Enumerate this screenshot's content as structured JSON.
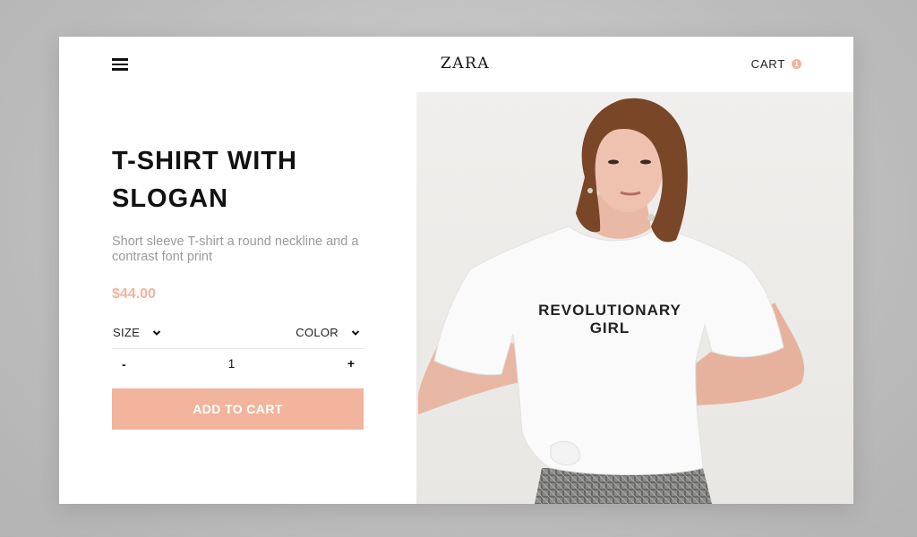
{
  "brand": {
    "logo": "ZARA"
  },
  "header": {
    "cart_label": "CART",
    "cart_count": "1"
  },
  "product": {
    "title_line1": "T-SHIRT WITH",
    "title_line2": "SLOGAN",
    "description": "Short sleeve T-shirt a round neckline and a contrast font print",
    "price": "$44.00",
    "print_line1": "REVOLUTIONARY",
    "print_line2": "GIRL"
  },
  "options": {
    "size_label": "SIZE",
    "color_label": "COLOR"
  },
  "quantity": {
    "minus": "-",
    "value": "1",
    "plus": "+"
  },
  "actions": {
    "add_to_cart": "ADD TO CART"
  },
  "colors": {
    "accent": "#f2b49c",
    "text": "#111111",
    "muted": "#9a9a9a"
  },
  "icons": {
    "menu": "hamburger-icon",
    "dropdown": "chevron-down-icon"
  }
}
